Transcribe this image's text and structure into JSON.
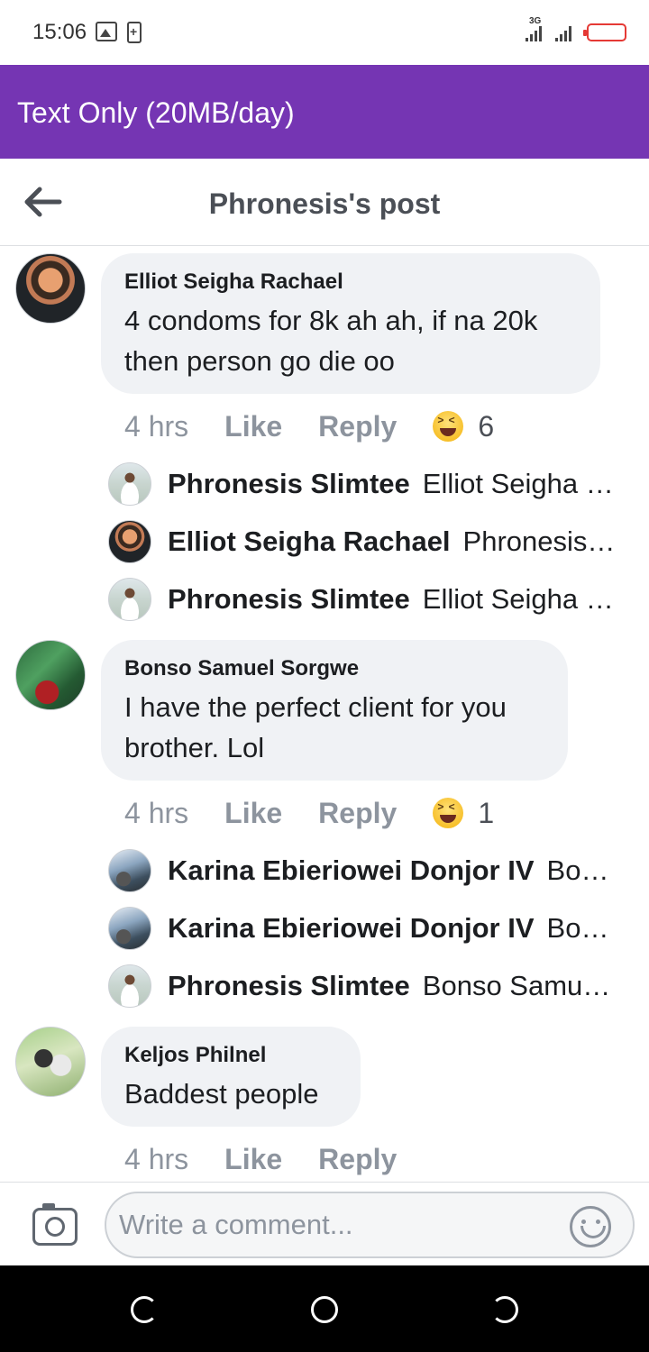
{
  "status_bar": {
    "time": "15:06",
    "network_label": "3G",
    "battery_color": "#e53935"
  },
  "banner": {
    "text": "Text Only (20MB/day)",
    "color": "#7535b3"
  },
  "header": {
    "title": "Phronesis's post",
    "back_icon": "arrow-left-icon"
  },
  "comments": [
    {
      "author": "Elliot Seigha Rachael",
      "lines": [
        "4 condoms for 8k ah ah, if na 20k",
        "then person go die oo"
      ],
      "time": "4 hrs",
      "like_label": "Like",
      "reply_label": "Reply",
      "reaction_icon": "haha-emoji-icon",
      "reaction_count": "6",
      "replies": [
        {
          "name": "Phronesis Slimtee",
          "text": "Elliot Seigha Rachael"
        },
        {
          "name": "Elliot Seigha Rachael",
          "text": "Phronesis Slimtee"
        },
        {
          "name": "Phronesis Slimtee",
          "text": "Elliot Seigha Rachael"
        }
      ]
    },
    {
      "author": "Bonso Samuel Sorgwe",
      "lines": [
        "I have the perfect client for you",
        "brother. Lol"
      ],
      "time": "4 hrs",
      "like_label": "Like",
      "reply_label": "Reply",
      "reaction_icon": "haha-emoji-icon",
      "reaction_count": "1",
      "replies": [
        {
          "name": "Karina Ebieriowei Donjor IV",
          "text": "Bonso Samuel Sorgwe"
        },
        {
          "name": "Karina Ebieriowei Donjor IV",
          "text": "Bonso Samuel Sorgwe"
        },
        {
          "name": "Phronesis Slimtee",
          "text": "Bonso Samuel Sorgwe"
        }
      ]
    },
    {
      "author": "Keljos Philnel",
      "lines": [
        "Baddest people"
      ],
      "time": "4 hrs",
      "like_label": "Like",
      "reply_label": "Reply"
    }
  ],
  "composer": {
    "placeholder": "Write a comment...",
    "camera_icon": "camera-icon",
    "emoji_icon": "smiley-icon"
  },
  "navbar": {
    "back_icon": "nav-back-icon",
    "home_icon": "nav-home-icon",
    "recents_icon": "nav-recents-icon"
  }
}
